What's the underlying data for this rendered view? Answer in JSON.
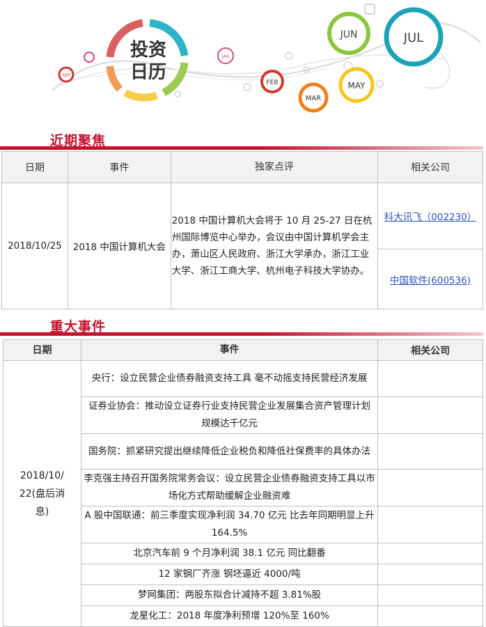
{
  "banner": {
    "logo_line1": "投资",
    "logo_line2": "日历",
    "months": [
      "SEP",
      "JAN",
      "FEB",
      "MAR",
      "MAY",
      "JUN",
      "JUL"
    ]
  },
  "focus": {
    "title": "近期聚焦",
    "headers": {
      "date": "日期",
      "event": "事件",
      "review": "独家点评",
      "company": "相关公司"
    },
    "row": {
      "date": "2018/10/25",
      "event": "2018 中国计算机大会",
      "review": "2018 中国计算机大会将于 10 月 25-27 日在杭州国际博览中心举办，会议由中国计算机学会主办，萧山区人民政府、浙江大学承办，浙江工业大学、浙江工商大学、杭州电子科技大学协办。",
      "companies": [
        "科大讯飞（002230）",
        "中国软件(600536)"
      ]
    }
  },
  "major": {
    "title": "重大事件",
    "headers": {
      "date": "日期",
      "event": "事件",
      "company": "相关公司"
    },
    "date": "2018/10/22(盘后消息)",
    "date_lines": [
      "2018/10/",
      "22(盘后消",
      "息)"
    ],
    "events": [
      "央行：设立民营企业债券融资支持工具 毫不动摇支持民营经济发展",
      "证券业协会：推动设立证券行业支持民营企业发展集合资产管理计划 规模达千亿元",
      "国务院：抓紧研究提出继续降低企业税负和降低社保费率的具体办法",
      "李克强主持召开国务院常务会议：设立民营企业债券融资支持工具以市场化方式帮助缓解企业融资难",
      "A 股中国联通：前三季度实现净利润 34.70 亿元 比去年同期明显上升 164.5%",
      "北京汽车前 9 个月净利润 38.1 亿元 同比翻番",
      "12 家钢厂齐涨 钢坯逼近 4000/吨",
      "梦网集团：两股东拟合计减持不超 3.81%股",
      "龙星化工：2018 年度净利预增 120%至 160%"
    ]
  },
  "colors": {
    "accent": "#c3132d",
    "link": "#2a52be",
    "jul": "#1ba3b8",
    "jun": "#8cc63f",
    "may": "#f7c51c",
    "mar": "#f07f1b",
    "feb": "#d8342a"
  }
}
